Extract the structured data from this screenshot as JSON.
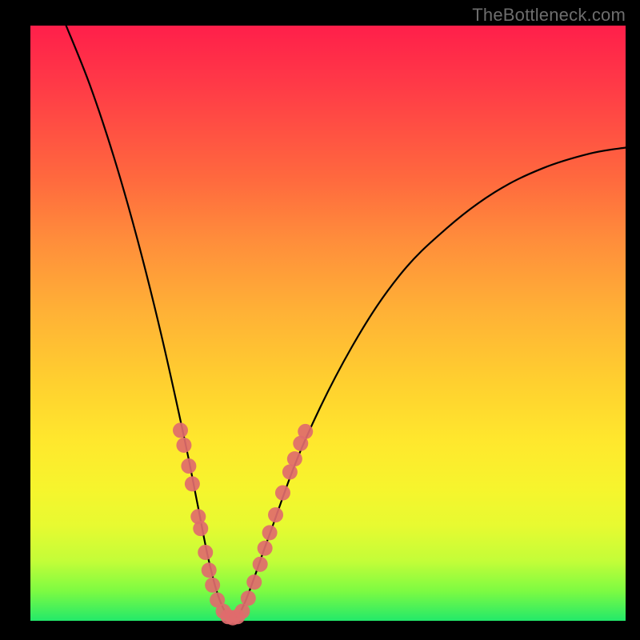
{
  "watermark": "TheBottleneck.com",
  "chart_data": {
    "type": "line",
    "title": "",
    "xlabel": "",
    "ylabel": "",
    "xlim": [
      0,
      100
    ],
    "ylim": [
      0,
      100
    ],
    "series": [
      {
        "name": "bottleneck-curve",
        "x": [
          6,
          10,
          14,
          18,
          22,
          26,
          28,
          30,
          32,
          34,
          36,
          40,
          46,
          54,
          62,
          70,
          78,
          86,
          94,
          100
        ],
        "values": [
          100,
          90,
          78,
          64,
          48,
          30,
          20,
          10,
          3,
          0.5,
          3,
          14,
          30,
          46,
          58,
          66,
          72,
          76,
          78.5,
          79.5
        ]
      }
    ],
    "markers": {
      "name": "highlight-dots",
      "color": "#e06b6d",
      "points": [
        {
          "x": 25.2,
          "y": 32
        },
        {
          "x": 25.8,
          "y": 29.5
        },
        {
          "x": 26.6,
          "y": 26
        },
        {
          "x": 27.2,
          "y": 23
        },
        {
          "x": 28.2,
          "y": 17.5
        },
        {
          "x": 28.6,
          "y": 15.5
        },
        {
          "x": 29.4,
          "y": 11.5
        },
        {
          "x": 30.0,
          "y": 8.5
        },
        {
          "x": 30.6,
          "y": 6
        },
        {
          "x": 31.4,
          "y": 3.5
        },
        {
          "x": 32.4,
          "y": 1.6
        },
        {
          "x": 33.2,
          "y": 0.7
        },
        {
          "x": 34.0,
          "y": 0.5
        },
        {
          "x": 34.8,
          "y": 0.7
        },
        {
          "x": 35.6,
          "y": 1.6
        },
        {
          "x": 36.6,
          "y": 3.8
        },
        {
          "x": 37.6,
          "y": 6.5
        },
        {
          "x": 38.6,
          "y": 9.5
        },
        {
          "x": 39.4,
          "y": 12.2
        },
        {
          "x": 40.2,
          "y": 14.8
        },
        {
          "x": 41.2,
          "y": 17.8
        },
        {
          "x": 42.4,
          "y": 21.5
        },
        {
          "x": 43.6,
          "y": 25
        },
        {
          "x": 44.4,
          "y": 27.2
        },
        {
          "x": 45.4,
          "y": 29.8
        },
        {
          "x": 46.2,
          "y": 31.8
        }
      ]
    },
    "gradient_stops": [
      {
        "pos": 0.0,
        "color": "#ff1f4a"
      },
      {
        "pos": 0.3,
        "color": "#ff7a3c"
      },
      {
        "pos": 0.6,
        "color": "#ffd02f"
      },
      {
        "pos": 0.82,
        "color": "#f2f62d"
      },
      {
        "pos": 1.0,
        "color": "#23e96a"
      }
    ]
  }
}
